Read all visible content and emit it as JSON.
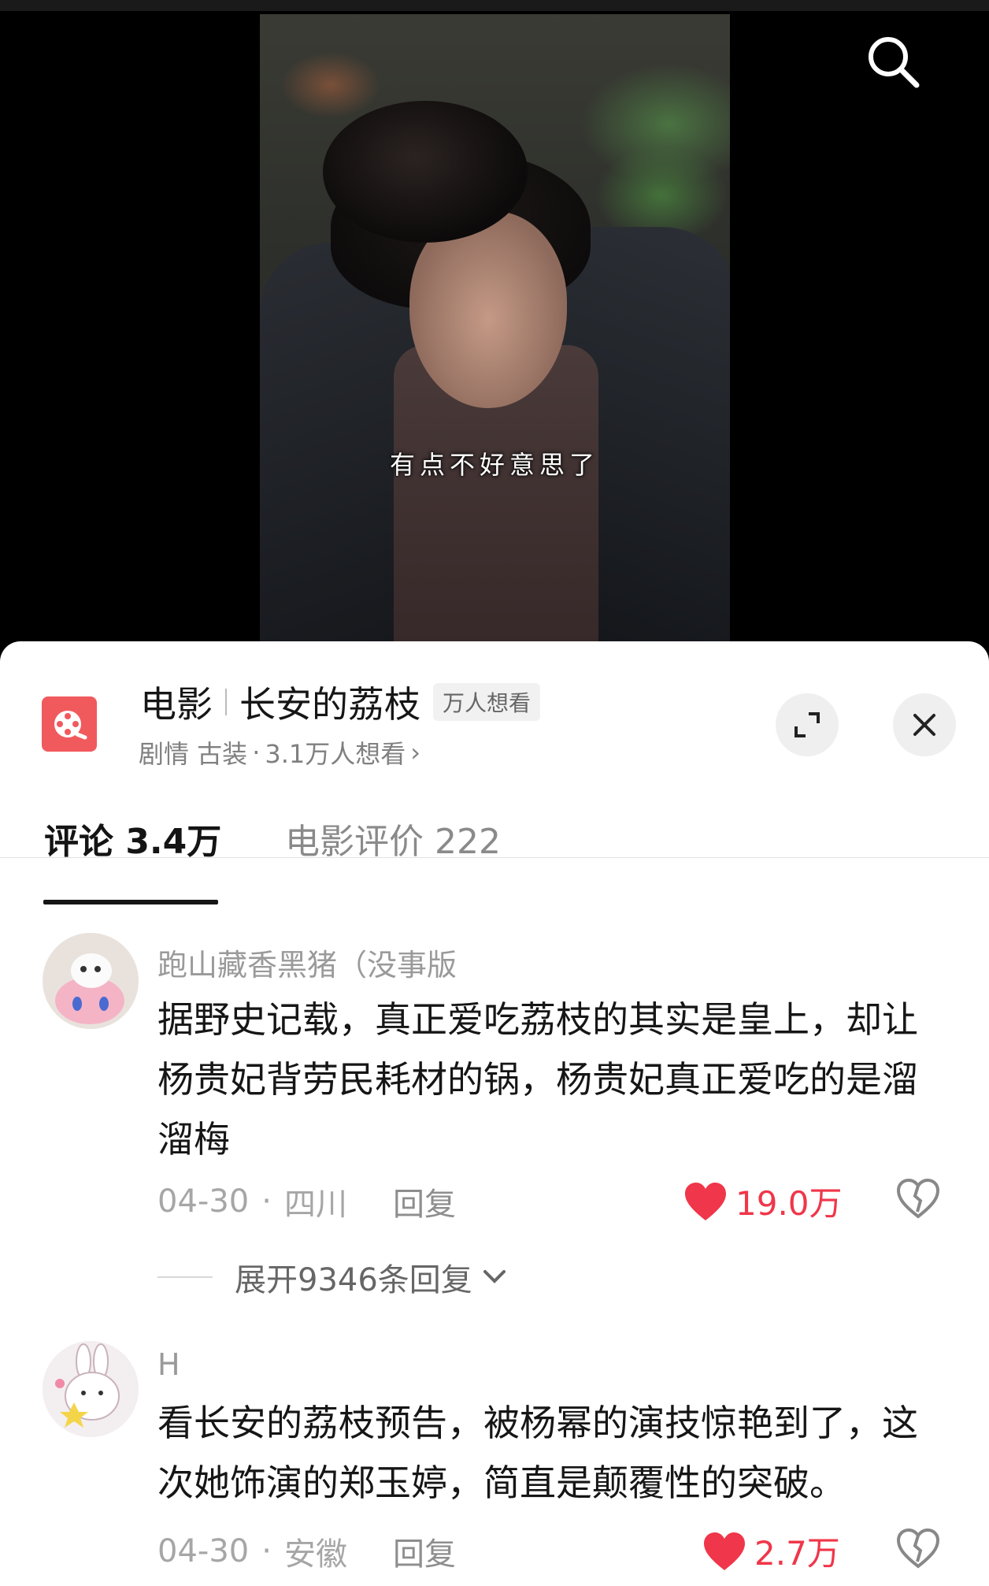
{
  "video": {
    "subtitle": "有点不好意思了",
    "search_icon": "search-icon"
  },
  "movie": {
    "category": "电影",
    "name": "长安的荔枝",
    "badge": "万人想看",
    "genres": "剧情 古装",
    "dot": "·",
    "wish_count": "3.1万人想看",
    "arrow": "›"
  },
  "tabs": [
    {
      "label": "评论 3.4万"
    },
    {
      "label": "电影评价 222"
    }
  ],
  "comments": [
    {
      "user": "跑山藏香黑猪（没事版",
      "text": "据野史记载，真正爱吃荔枝的其实是皇上，却让杨贵妃背劳民耗材的锅，杨贵妃真正爱吃的是溜溜梅",
      "date": "04-30",
      "location": "四川",
      "reply_label": "回复",
      "likes": "19.0万",
      "expand_replies": "展开9346条回复"
    },
    {
      "user": "H",
      "text": "看长安的荔枝预告，被杨幂的演技惊艳到了，这次她饰演的郑玉婷，简直是颠覆性的突破。",
      "date": "04-30",
      "location": "安徽",
      "reply_label": "回复",
      "likes": "2.7万"
    }
  ],
  "colors": {
    "accent_red": "#f0364a",
    "logo_red": "#f15a5d"
  }
}
